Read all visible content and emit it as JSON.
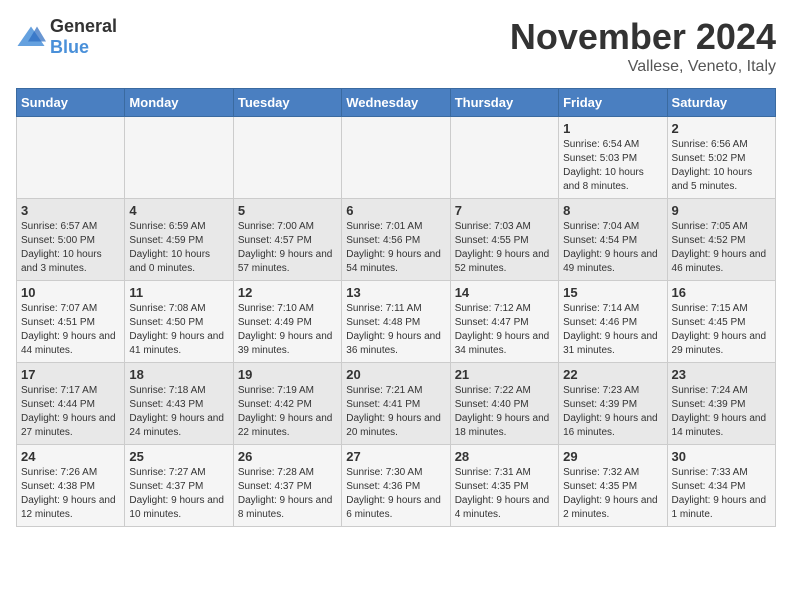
{
  "header": {
    "logo_general": "General",
    "logo_blue": "Blue",
    "title": "November 2024",
    "location": "Vallese, Veneto, Italy"
  },
  "days_of_week": [
    "Sunday",
    "Monday",
    "Tuesday",
    "Wednesday",
    "Thursday",
    "Friday",
    "Saturday"
  ],
  "weeks": [
    [
      {
        "day": "",
        "info": ""
      },
      {
        "day": "",
        "info": ""
      },
      {
        "day": "",
        "info": ""
      },
      {
        "day": "",
        "info": ""
      },
      {
        "day": "",
        "info": ""
      },
      {
        "day": "1",
        "info": "Sunrise: 6:54 AM\nSunset: 5:03 PM\nDaylight: 10 hours and 8 minutes."
      },
      {
        "day": "2",
        "info": "Sunrise: 6:56 AM\nSunset: 5:02 PM\nDaylight: 10 hours and 5 minutes."
      }
    ],
    [
      {
        "day": "3",
        "info": "Sunrise: 6:57 AM\nSunset: 5:00 PM\nDaylight: 10 hours and 3 minutes."
      },
      {
        "day": "4",
        "info": "Sunrise: 6:59 AM\nSunset: 4:59 PM\nDaylight: 10 hours and 0 minutes."
      },
      {
        "day": "5",
        "info": "Sunrise: 7:00 AM\nSunset: 4:57 PM\nDaylight: 9 hours and 57 minutes."
      },
      {
        "day": "6",
        "info": "Sunrise: 7:01 AM\nSunset: 4:56 PM\nDaylight: 9 hours and 54 minutes."
      },
      {
        "day": "7",
        "info": "Sunrise: 7:03 AM\nSunset: 4:55 PM\nDaylight: 9 hours and 52 minutes."
      },
      {
        "day": "8",
        "info": "Sunrise: 7:04 AM\nSunset: 4:54 PM\nDaylight: 9 hours and 49 minutes."
      },
      {
        "day": "9",
        "info": "Sunrise: 7:05 AM\nSunset: 4:52 PM\nDaylight: 9 hours and 46 minutes."
      }
    ],
    [
      {
        "day": "10",
        "info": "Sunrise: 7:07 AM\nSunset: 4:51 PM\nDaylight: 9 hours and 44 minutes."
      },
      {
        "day": "11",
        "info": "Sunrise: 7:08 AM\nSunset: 4:50 PM\nDaylight: 9 hours and 41 minutes."
      },
      {
        "day": "12",
        "info": "Sunrise: 7:10 AM\nSunset: 4:49 PM\nDaylight: 9 hours and 39 minutes."
      },
      {
        "day": "13",
        "info": "Sunrise: 7:11 AM\nSunset: 4:48 PM\nDaylight: 9 hours and 36 minutes."
      },
      {
        "day": "14",
        "info": "Sunrise: 7:12 AM\nSunset: 4:47 PM\nDaylight: 9 hours and 34 minutes."
      },
      {
        "day": "15",
        "info": "Sunrise: 7:14 AM\nSunset: 4:46 PM\nDaylight: 9 hours and 31 minutes."
      },
      {
        "day": "16",
        "info": "Sunrise: 7:15 AM\nSunset: 4:45 PM\nDaylight: 9 hours and 29 minutes."
      }
    ],
    [
      {
        "day": "17",
        "info": "Sunrise: 7:17 AM\nSunset: 4:44 PM\nDaylight: 9 hours and 27 minutes."
      },
      {
        "day": "18",
        "info": "Sunrise: 7:18 AM\nSunset: 4:43 PM\nDaylight: 9 hours and 24 minutes."
      },
      {
        "day": "19",
        "info": "Sunrise: 7:19 AM\nSunset: 4:42 PM\nDaylight: 9 hours and 22 minutes."
      },
      {
        "day": "20",
        "info": "Sunrise: 7:21 AM\nSunset: 4:41 PM\nDaylight: 9 hours and 20 minutes."
      },
      {
        "day": "21",
        "info": "Sunrise: 7:22 AM\nSunset: 4:40 PM\nDaylight: 9 hours and 18 minutes."
      },
      {
        "day": "22",
        "info": "Sunrise: 7:23 AM\nSunset: 4:39 PM\nDaylight: 9 hours and 16 minutes."
      },
      {
        "day": "23",
        "info": "Sunrise: 7:24 AM\nSunset: 4:39 PM\nDaylight: 9 hours and 14 minutes."
      }
    ],
    [
      {
        "day": "24",
        "info": "Sunrise: 7:26 AM\nSunset: 4:38 PM\nDaylight: 9 hours and 12 minutes."
      },
      {
        "day": "25",
        "info": "Sunrise: 7:27 AM\nSunset: 4:37 PM\nDaylight: 9 hours and 10 minutes."
      },
      {
        "day": "26",
        "info": "Sunrise: 7:28 AM\nSunset: 4:37 PM\nDaylight: 9 hours and 8 minutes."
      },
      {
        "day": "27",
        "info": "Sunrise: 7:30 AM\nSunset: 4:36 PM\nDaylight: 9 hours and 6 minutes."
      },
      {
        "day": "28",
        "info": "Sunrise: 7:31 AM\nSunset: 4:35 PM\nDaylight: 9 hours and 4 minutes."
      },
      {
        "day": "29",
        "info": "Sunrise: 7:32 AM\nSunset: 4:35 PM\nDaylight: 9 hours and 2 minutes."
      },
      {
        "day": "30",
        "info": "Sunrise: 7:33 AM\nSunset: 4:34 PM\nDaylight: 9 hours and 1 minute."
      }
    ]
  ]
}
